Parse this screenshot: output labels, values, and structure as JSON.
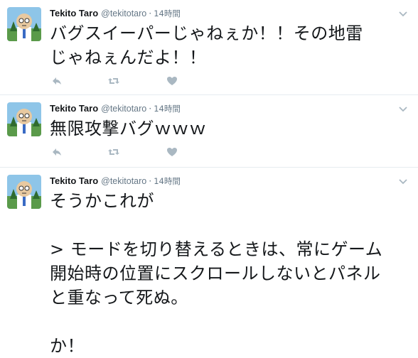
{
  "tweets": [
    {
      "fullname": "Tekito Taro",
      "username": "@tekitotaro",
      "separator": "·",
      "time": "14時間",
      "text": "バグスイーパーじゃねぇか！！その地雷\nじゃねぇんだよ！！"
    },
    {
      "fullname": "Tekito Taro",
      "username": "@tekitotaro",
      "separator": "·",
      "time": "14時間",
      "text": "無限攻撃バグｗｗｗ"
    },
    {
      "fullname": "Tekito Taro",
      "username": "@tekitotaro",
      "separator": "·",
      "time": "14時間",
      "text": "そうかこれが\n\n> モードを切り替えるときは、常にゲーム\n開始時の位置にスクロールしないとパネル\nと重なって死ぬ。\n\nか！"
    }
  ],
  "icons": {
    "reply": "reply-icon",
    "retweet": "retweet-icon",
    "like": "heart-icon",
    "more": "chevron-down-icon"
  },
  "colors": {
    "icon_gray": "#aab8c2",
    "meta_gray": "#657786",
    "text": "#14171a",
    "divider": "#e6ecf0"
  }
}
